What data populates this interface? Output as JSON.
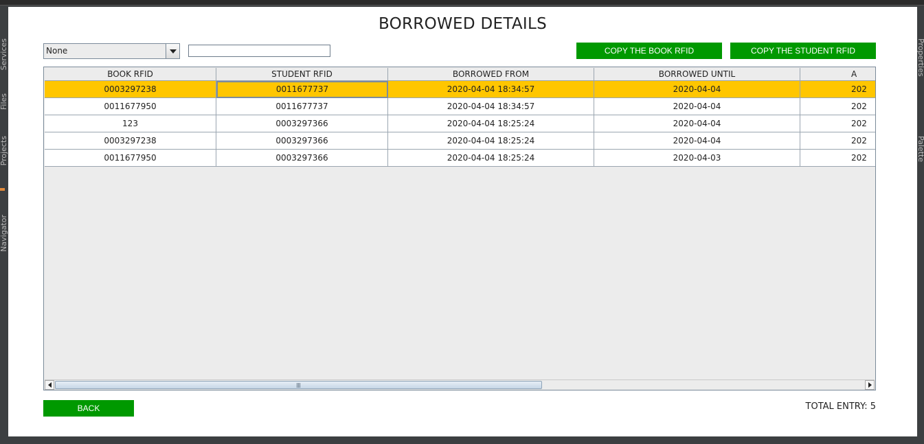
{
  "ide": {
    "left_tabs": [
      "Services",
      "Files",
      "Projects",
      "Navigator"
    ],
    "right_tabs": [
      "Properties",
      "Palette"
    ]
  },
  "title": "BORROWED DETAILS",
  "filter": {
    "selected": "None",
    "search_value": ""
  },
  "buttons": {
    "copy_book": "COPY THE BOOK RFID",
    "copy_student": "COPY THE STUDENT RFID",
    "back": "BACK"
  },
  "table": {
    "columns": [
      "BOOK RFID",
      "STUDENT RFID",
      "BORROWED FROM",
      "BORROWED UNTIL",
      "A"
    ],
    "rows": [
      [
        "0003297238",
        "0011677737",
        "2020-04-04 18:34:57",
        "2020-04-04",
        "202"
      ],
      [
        "0011677950",
        "0011677737",
        "2020-04-04 18:34:57",
        "2020-04-04",
        "202"
      ],
      [
        "123",
        "0003297366",
        "2020-04-04 18:25:24",
        "2020-04-04",
        "202"
      ],
      [
        "0003297238",
        "0003297366",
        "2020-04-04 18:25:24",
        "2020-04-04",
        "202"
      ],
      [
        "0011677950",
        "0003297366",
        "2020-04-04 18:25:24",
        "2020-04-03",
        "202"
      ]
    ],
    "selected_row": 0
  },
  "total_entry": "TOTAL ENTRY: 5",
  "colors": {
    "green": "#009900",
    "selection": "#ffc600"
  }
}
